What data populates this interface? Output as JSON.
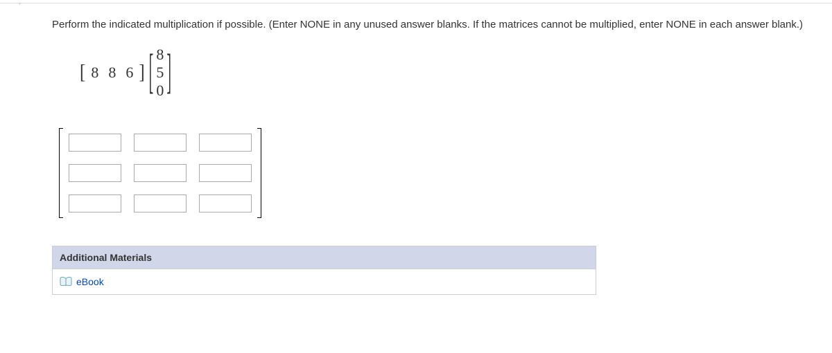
{
  "question": {
    "text": "Perform the indicated multiplication if possible. (Enter NONE in any unused answer blanks. If the matrices cannot be multiplied, enter NONE in each answer blank.)"
  },
  "matrices": {
    "row": [
      "8",
      "8",
      "6"
    ],
    "col": [
      "8",
      "5",
      "0"
    ]
  },
  "additional": {
    "header": "Additional Materials",
    "ebook": "eBook"
  }
}
